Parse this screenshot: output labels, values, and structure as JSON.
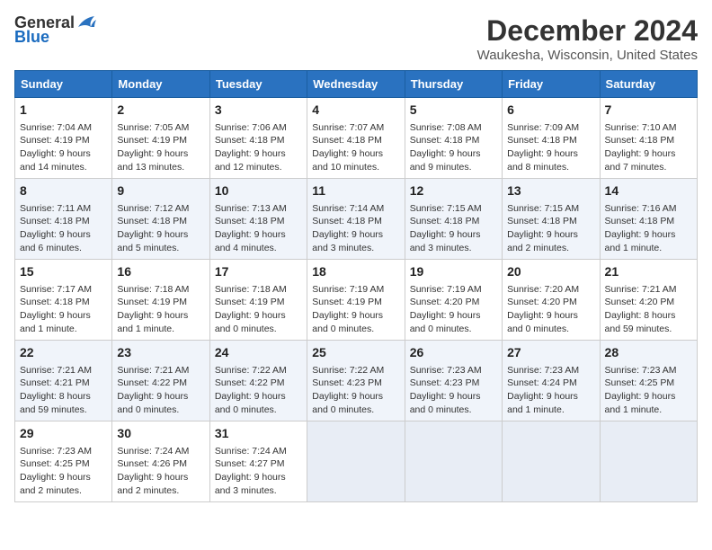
{
  "header": {
    "logo_general": "General",
    "logo_blue": "Blue",
    "month_year": "December 2024",
    "location": "Waukesha, Wisconsin, United States"
  },
  "days_of_week": [
    "Sunday",
    "Monday",
    "Tuesday",
    "Wednesday",
    "Thursday",
    "Friday",
    "Saturday"
  ],
  "weeks": [
    [
      {
        "day": 1,
        "sunrise": "Sunrise: 7:04 AM",
        "sunset": "Sunset: 4:19 PM",
        "daylight": "Daylight: 9 hours and 14 minutes."
      },
      {
        "day": 2,
        "sunrise": "Sunrise: 7:05 AM",
        "sunset": "Sunset: 4:19 PM",
        "daylight": "Daylight: 9 hours and 13 minutes."
      },
      {
        "day": 3,
        "sunrise": "Sunrise: 7:06 AM",
        "sunset": "Sunset: 4:18 PM",
        "daylight": "Daylight: 9 hours and 12 minutes."
      },
      {
        "day": 4,
        "sunrise": "Sunrise: 7:07 AM",
        "sunset": "Sunset: 4:18 PM",
        "daylight": "Daylight: 9 hours and 10 minutes."
      },
      {
        "day": 5,
        "sunrise": "Sunrise: 7:08 AM",
        "sunset": "Sunset: 4:18 PM",
        "daylight": "Daylight: 9 hours and 9 minutes."
      },
      {
        "day": 6,
        "sunrise": "Sunrise: 7:09 AM",
        "sunset": "Sunset: 4:18 PM",
        "daylight": "Daylight: 9 hours and 8 minutes."
      },
      {
        "day": 7,
        "sunrise": "Sunrise: 7:10 AM",
        "sunset": "Sunset: 4:18 PM",
        "daylight": "Daylight: 9 hours and 7 minutes."
      }
    ],
    [
      {
        "day": 8,
        "sunrise": "Sunrise: 7:11 AM",
        "sunset": "Sunset: 4:18 PM",
        "daylight": "Daylight: 9 hours and 6 minutes."
      },
      {
        "day": 9,
        "sunrise": "Sunrise: 7:12 AM",
        "sunset": "Sunset: 4:18 PM",
        "daylight": "Daylight: 9 hours and 5 minutes."
      },
      {
        "day": 10,
        "sunrise": "Sunrise: 7:13 AM",
        "sunset": "Sunset: 4:18 PM",
        "daylight": "Daylight: 9 hours and 4 minutes."
      },
      {
        "day": 11,
        "sunrise": "Sunrise: 7:14 AM",
        "sunset": "Sunset: 4:18 PM",
        "daylight": "Daylight: 9 hours and 3 minutes."
      },
      {
        "day": 12,
        "sunrise": "Sunrise: 7:15 AM",
        "sunset": "Sunset: 4:18 PM",
        "daylight": "Daylight: 9 hours and 3 minutes."
      },
      {
        "day": 13,
        "sunrise": "Sunrise: 7:15 AM",
        "sunset": "Sunset: 4:18 PM",
        "daylight": "Daylight: 9 hours and 2 minutes."
      },
      {
        "day": 14,
        "sunrise": "Sunrise: 7:16 AM",
        "sunset": "Sunset: 4:18 PM",
        "daylight": "Daylight: 9 hours and 1 minute."
      }
    ],
    [
      {
        "day": 15,
        "sunrise": "Sunrise: 7:17 AM",
        "sunset": "Sunset: 4:18 PM",
        "daylight": "Daylight: 9 hours and 1 minute."
      },
      {
        "day": 16,
        "sunrise": "Sunrise: 7:18 AM",
        "sunset": "Sunset: 4:19 PM",
        "daylight": "Daylight: 9 hours and 1 minute."
      },
      {
        "day": 17,
        "sunrise": "Sunrise: 7:18 AM",
        "sunset": "Sunset: 4:19 PM",
        "daylight": "Daylight: 9 hours and 0 minutes."
      },
      {
        "day": 18,
        "sunrise": "Sunrise: 7:19 AM",
        "sunset": "Sunset: 4:19 PM",
        "daylight": "Daylight: 9 hours and 0 minutes."
      },
      {
        "day": 19,
        "sunrise": "Sunrise: 7:19 AM",
        "sunset": "Sunset: 4:20 PM",
        "daylight": "Daylight: 9 hours and 0 minutes."
      },
      {
        "day": 20,
        "sunrise": "Sunrise: 7:20 AM",
        "sunset": "Sunset: 4:20 PM",
        "daylight": "Daylight: 9 hours and 0 minutes."
      },
      {
        "day": 21,
        "sunrise": "Sunrise: 7:21 AM",
        "sunset": "Sunset: 4:20 PM",
        "daylight": "Daylight: 8 hours and 59 minutes."
      }
    ],
    [
      {
        "day": 22,
        "sunrise": "Sunrise: 7:21 AM",
        "sunset": "Sunset: 4:21 PM",
        "daylight": "Daylight: 8 hours and 59 minutes."
      },
      {
        "day": 23,
        "sunrise": "Sunrise: 7:21 AM",
        "sunset": "Sunset: 4:22 PM",
        "daylight": "Daylight: 9 hours and 0 minutes."
      },
      {
        "day": 24,
        "sunrise": "Sunrise: 7:22 AM",
        "sunset": "Sunset: 4:22 PM",
        "daylight": "Daylight: 9 hours and 0 minutes."
      },
      {
        "day": 25,
        "sunrise": "Sunrise: 7:22 AM",
        "sunset": "Sunset: 4:23 PM",
        "daylight": "Daylight: 9 hours and 0 minutes."
      },
      {
        "day": 26,
        "sunrise": "Sunrise: 7:23 AM",
        "sunset": "Sunset: 4:23 PM",
        "daylight": "Daylight: 9 hours and 0 minutes."
      },
      {
        "day": 27,
        "sunrise": "Sunrise: 7:23 AM",
        "sunset": "Sunset: 4:24 PM",
        "daylight": "Daylight: 9 hours and 1 minute."
      },
      {
        "day": 28,
        "sunrise": "Sunrise: 7:23 AM",
        "sunset": "Sunset: 4:25 PM",
        "daylight": "Daylight: 9 hours and 1 minute."
      }
    ],
    [
      {
        "day": 29,
        "sunrise": "Sunrise: 7:23 AM",
        "sunset": "Sunset: 4:25 PM",
        "daylight": "Daylight: 9 hours and 2 minutes."
      },
      {
        "day": 30,
        "sunrise": "Sunrise: 7:24 AM",
        "sunset": "Sunset: 4:26 PM",
        "daylight": "Daylight: 9 hours and 2 minutes."
      },
      {
        "day": 31,
        "sunrise": "Sunrise: 7:24 AM",
        "sunset": "Sunset: 4:27 PM",
        "daylight": "Daylight: 9 hours and 3 minutes."
      },
      null,
      null,
      null,
      null
    ]
  ]
}
